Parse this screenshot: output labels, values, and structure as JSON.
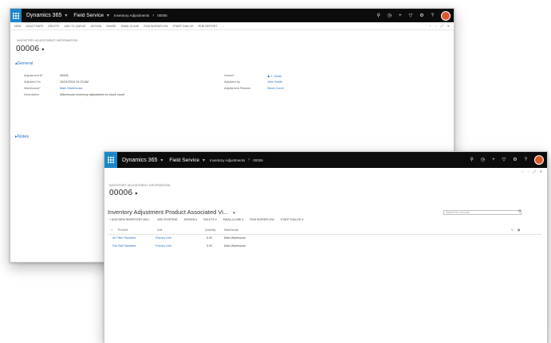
{
  "shell": {
    "brand": "Dynamics 365",
    "app": "Field Service",
    "crumb": "Inventory Adjustments",
    "crumb2": "00006",
    "colors": {
      "topbar": "#0c0c0c",
      "accent": "#1a87c9",
      "link": "#1f6fc5",
      "avatar": "#e0582a"
    }
  },
  "back_window": {
    "commands": [
      "NEW",
      "DEACTIVATE",
      "DELETE",
      "ADD TO QUEUE",
      "ASSIGN",
      "SHARE",
      "EMAIL A LINK",
      "RUN WORKFLOW",
      "START DIALOG",
      "RUN REPORT",
      "..."
    ],
    "entity_label": "INVENTORY ADJUSTMENT: INFORMATION",
    "record": "00006",
    "section_general": "General",
    "section_notes": "Notes",
    "fields_left": [
      {
        "label": "Adjustment #",
        "value": "00006",
        "required": true,
        "link": false
      },
      {
        "label": "Adjusted On",
        "value": "10/24/2016 10:23 AM",
        "required": false,
        "link": false
      },
      {
        "label": "Warehouse",
        "value": "Main Warehouse",
        "required": true,
        "link": true
      },
      {
        "label": "Description",
        "value": "Warehouse inventory adjustment for stock count",
        "required": false,
        "link": false
      }
    ],
    "fields_right": [
      {
        "label": "Owner",
        "value": "J. Smith",
        "required": true,
        "link": true
      },
      {
        "label": "Adjusted by",
        "value": "John Smith",
        "required": false,
        "link": true
      },
      {
        "label": "Adjustment Reason",
        "value": "Stock Count",
        "required": false,
        "link": true
      }
    ]
  },
  "front_window": {
    "entity_label": "INVENTORY ADJUSTMENT: INFORMATION",
    "record": "00006",
    "grid_title": "Inventory Adjustment Product Associated Vi...",
    "grid_commands": [
      "ADD NEW INVENTORY ADJ...",
      "ADD EXISTING",
      "ASSIGN",
      "DELETE",
      "EMAIL A LINK",
      "RUN WORKFLOW",
      "START DIALOG"
    ],
    "search_placeholder": "Search for records",
    "columns": [
      "Product",
      "Unit",
      "Quantity",
      "Warehouse"
    ],
    "rows": [
      {
        "product": "Air Filter Standard",
        "unit": "Primary Unit",
        "quantity": "5.00",
        "warehouse": "Main Warehouse"
      },
      {
        "product": "Fan Belt Standard",
        "unit": "Primary Unit",
        "quantity": "3.00",
        "warehouse": "Main Warehouse"
      }
    ]
  }
}
